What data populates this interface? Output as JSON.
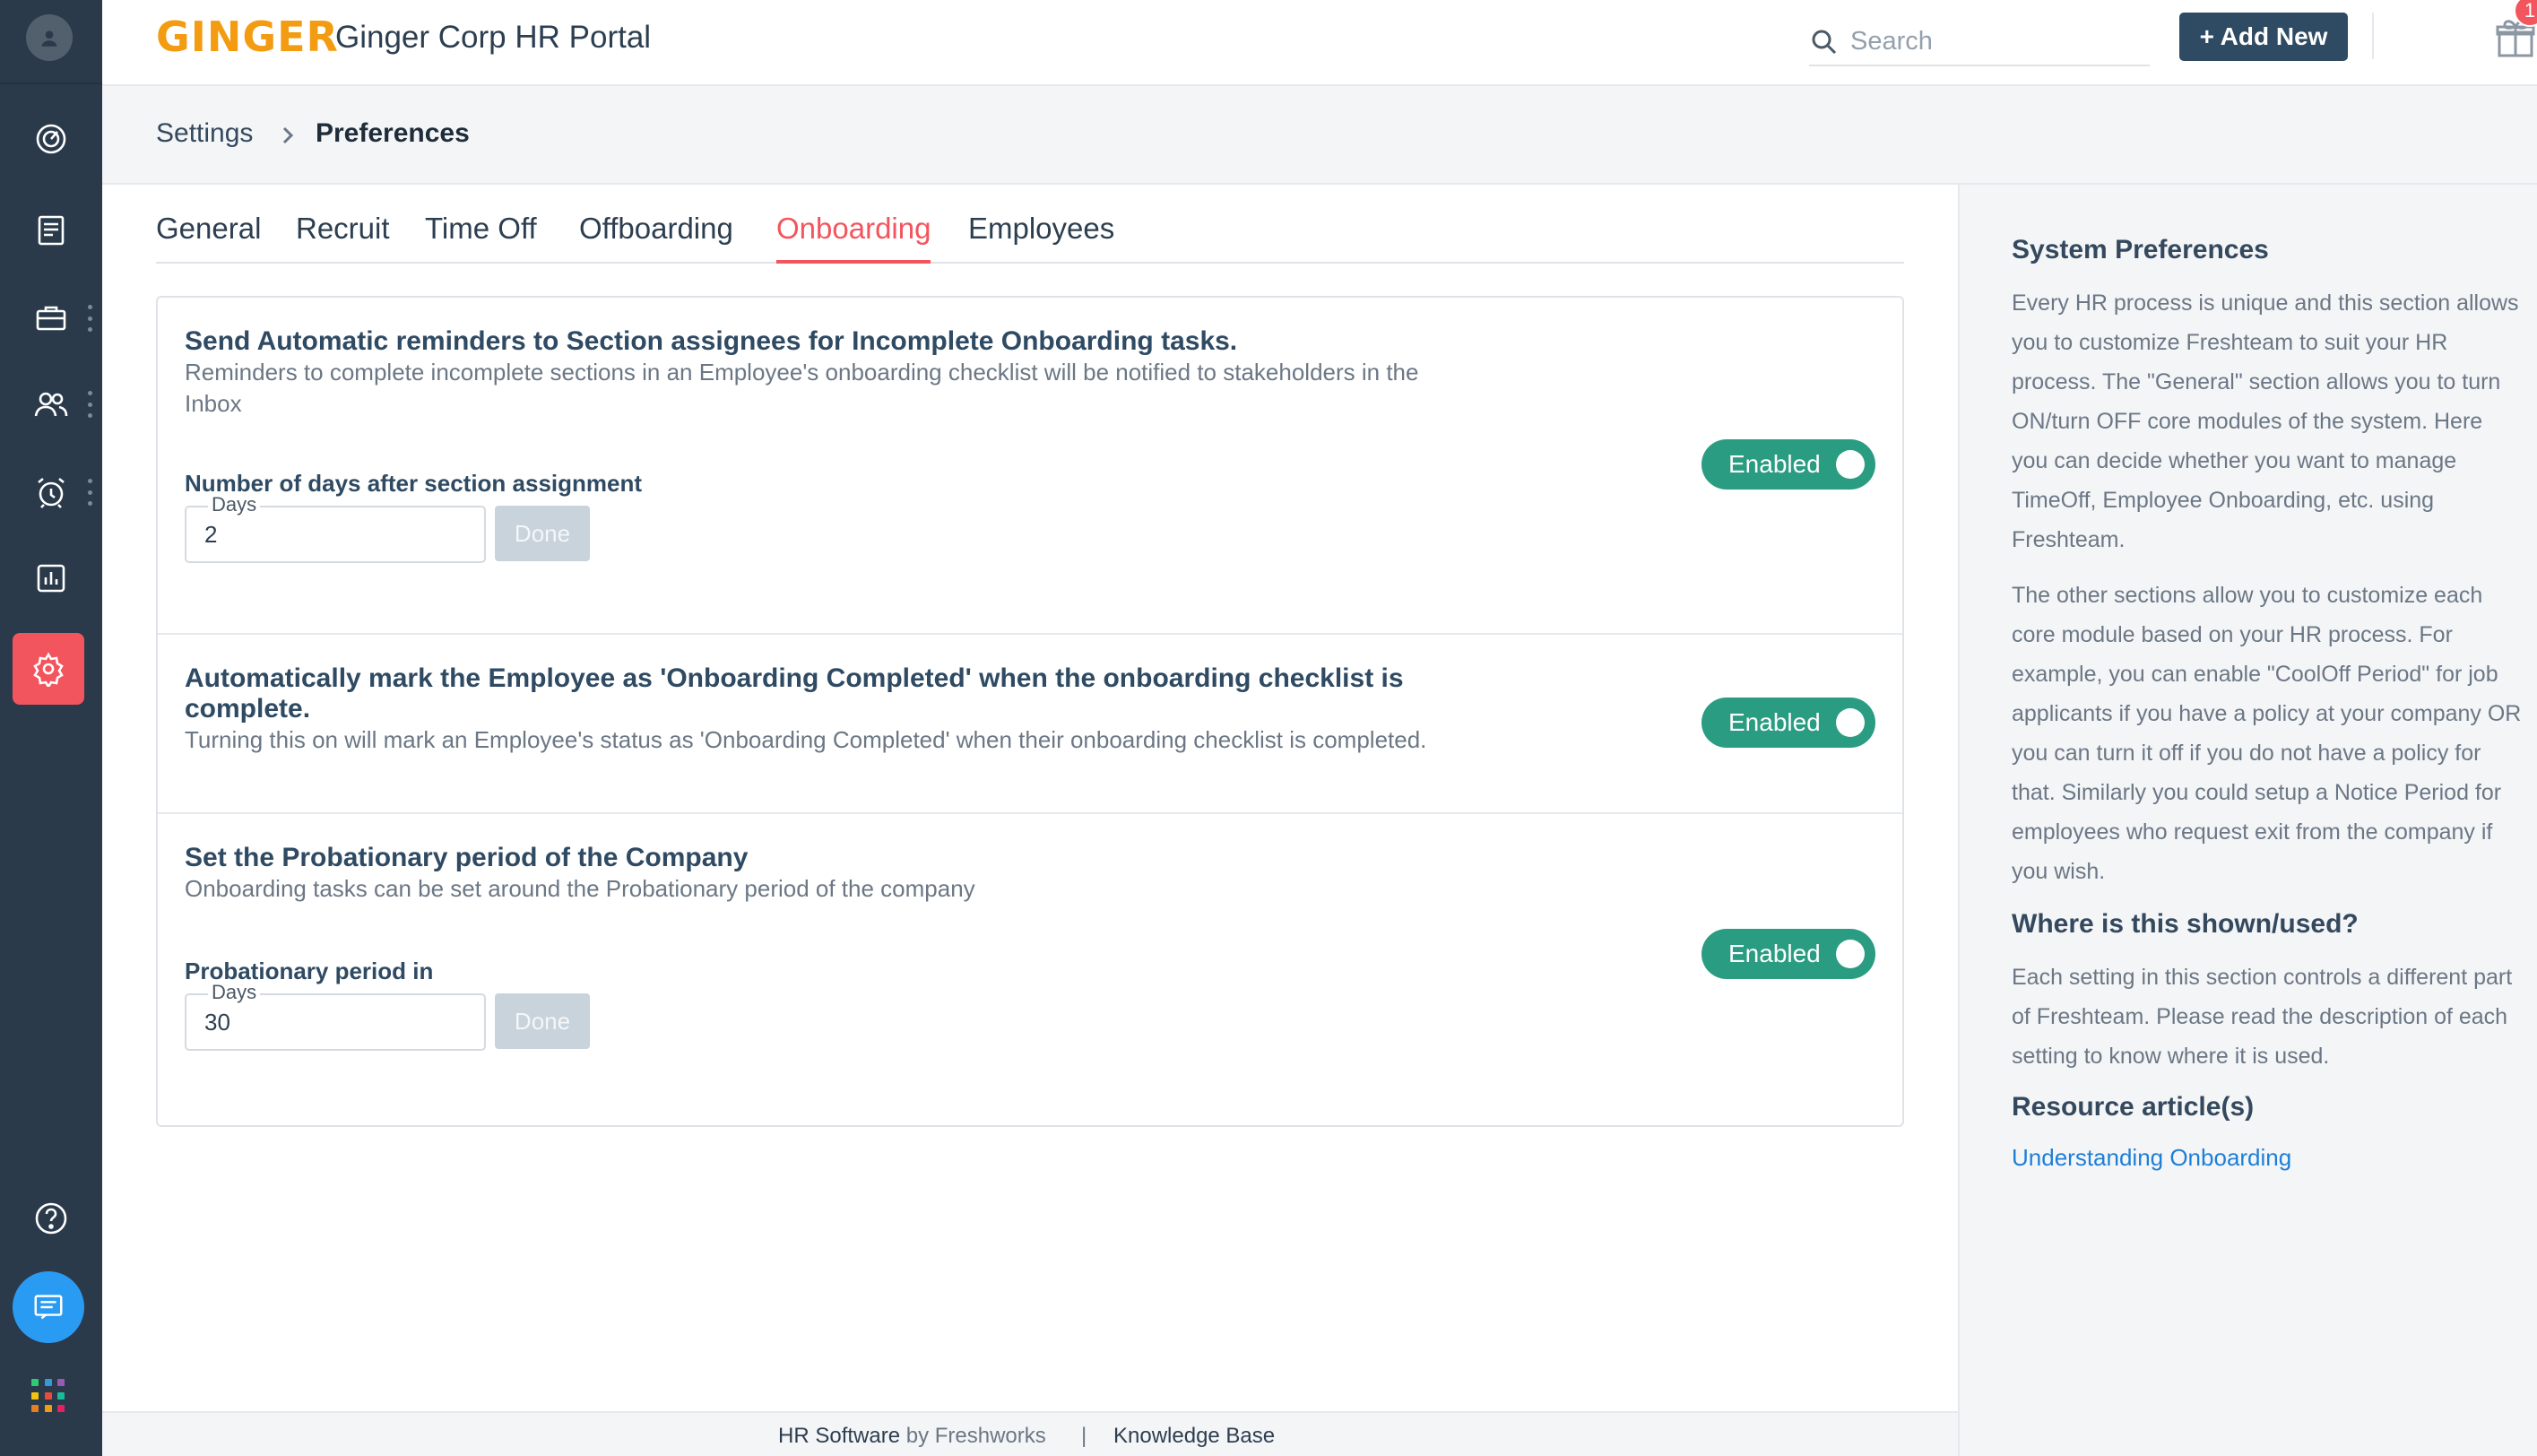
{
  "app": {
    "logo_text": "GINGER",
    "title": "Ginger Corp HR Portal"
  },
  "header": {
    "search_placeholder": "Search",
    "add_new_label": "+ Add New",
    "notification_count": "1"
  },
  "breadcrumb": {
    "root": "Settings",
    "current": "Preferences"
  },
  "tabs": [
    {
      "label": "General"
    },
    {
      "label": "Recruit"
    },
    {
      "label": "Time Off"
    },
    {
      "label": "Offboarding"
    },
    {
      "label": "Onboarding",
      "active": true
    },
    {
      "label": "Employees"
    }
  ],
  "sections": [
    {
      "title": "Send Automatic reminders to Section assignees for Incomplete Onboarding tasks.",
      "description": "Reminders to complete incomplete sections in an Employee's onboarding checklist will be notified to stakeholders in the Inbox",
      "field_label": "Number of days after section assignment",
      "unit_label": "Days",
      "value": "2",
      "done_label": "Done",
      "toggle_label": "Enabled"
    },
    {
      "title": "Automatically mark the Employee as 'Onboarding Completed' when the onboarding checklist is complete.",
      "description": "Turning this on will mark an Employee's status as 'Onboarding Completed' when their onboarding checklist is completed.",
      "toggle_label": "Enabled"
    },
    {
      "title": "Set the Probationary period of the Company",
      "description": "Onboarding tasks can be set around the Probationary period of the company",
      "field_label": "Probationary period in",
      "unit_label": "Days",
      "value": "30",
      "done_label": "Done",
      "toggle_label": "Enabled"
    }
  ],
  "footer": {
    "product": "HR Software",
    "by": " by Freshworks",
    "separator": "|",
    "knowledge_base": "Knowledge Base"
  },
  "help_panel": {
    "heading": "System Preferences",
    "para1": "Every HR process is unique and this section allows you to customize Freshteam to suit your HR process. The \"General\" section allows you to turn ON/turn OFF core modules of the system. Here you can decide whether you want to manage TimeOff, Employee Onboarding, etc. using Freshteam.",
    "para2": "The other sections allow you to customize each core module based on your HR process. For example, you can enable \"CoolOff Period\" for job applicants if you have a policy at your company OR you can turn it off if you do not have a policy for that. Similarly you could setup a Notice Period for employees who request exit from the company if you wish.",
    "heading2": "Where is this shown/used?",
    "para3": "Each setting in this section controls a different part of Freshteam. Please read the description of each setting to know where it is used.",
    "heading3": "Resource article(s)",
    "link": "Understanding Onboarding"
  },
  "colors": {
    "sidebar": "#2b3a4a",
    "accent_red": "#f2555d",
    "toggle_green": "#2a9c82",
    "header_button": "#2f4a63",
    "logo_orange": "#f39c12",
    "link_blue": "#1e7fd6"
  },
  "icons": {
    "sidebar": [
      "profile-icon",
      "dashboard-icon",
      "checklist-icon",
      "briefcase-icon",
      "people-icon",
      "alarm-icon",
      "reports-icon",
      "settings-icon",
      "help-icon",
      "chat-icon",
      "apps-grid-icon"
    ],
    "header": [
      "search-icon",
      "gift-icon"
    ]
  }
}
